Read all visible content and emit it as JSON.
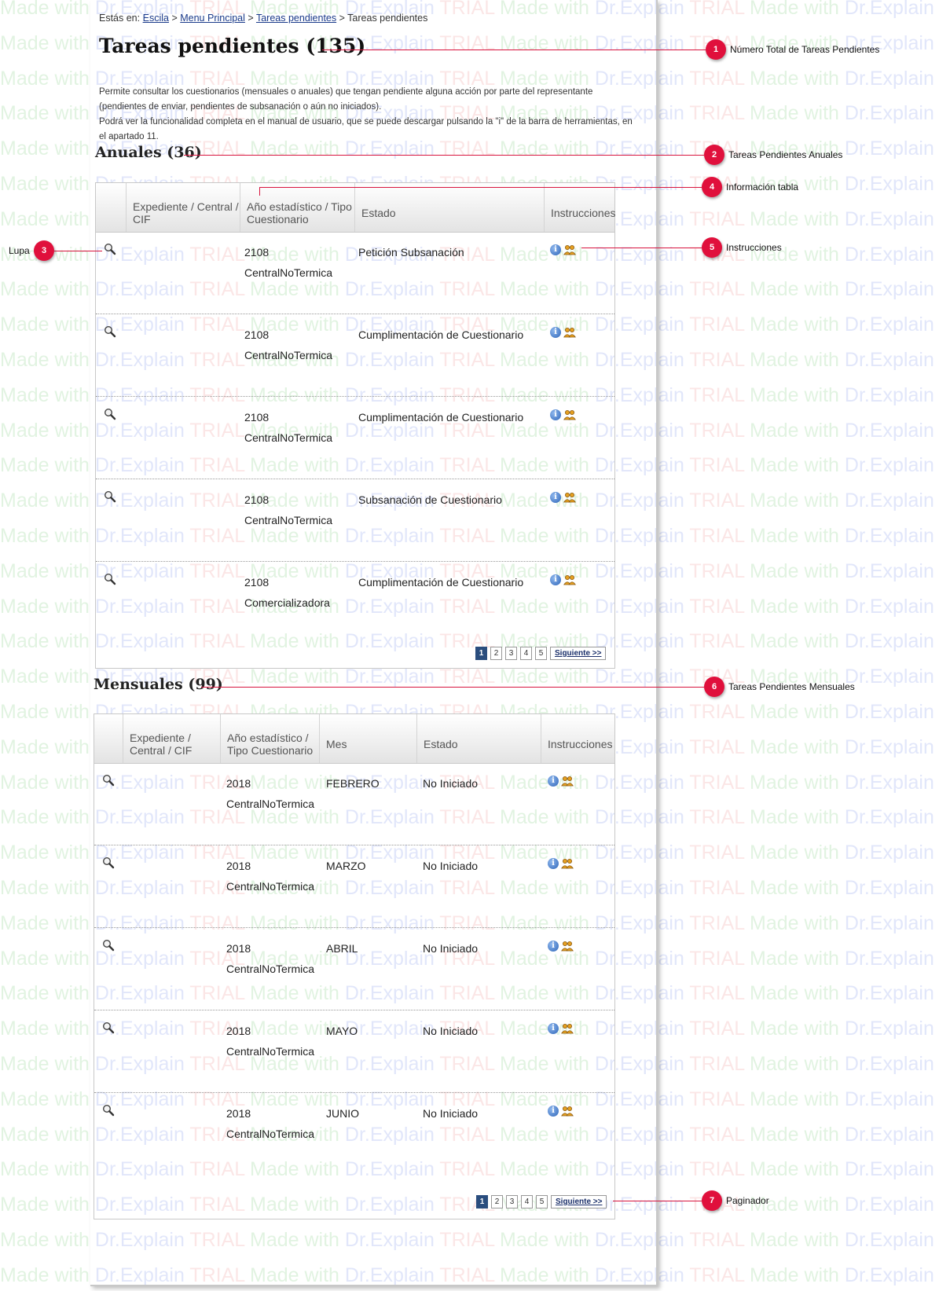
{
  "watermark": {
    "made": "Made with",
    "brand": "Dr.Explain",
    "trial": "TRIAL"
  },
  "breadcrumb": {
    "prefix": "Estás en:",
    "items": [
      "Escila",
      "Menu Principal",
      "Tareas pendientes"
    ],
    "current": "Tareas pendientes",
    "separator": ">"
  },
  "page_title": "Tareas pendientes (135)",
  "description": {
    "line1": "Permite consultar los cuestionarios (mensuales o anuales) que tengan pendiente alguna acción por parte del representante (pendientes de enviar, pendientes de subsanación o aún no iniciados).",
    "line2": "Podrá ver la funcionalidad completa en el manual de usuario, que se puede descargar pulsando la \"i\" de la barra de herramientas, en el apartado 11."
  },
  "anuales": {
    "title": "Anuales (36)",
    "headers": [
      "",
      "Expediente / Central / CIF",
      "Año estadístico / Tipo Cuestionario",
      "Estado",
      "Instrucciones"
    ],
    "rows": [
      {
        "year": "2108",
        "type": "CentralNoTermica",
        "estado": "Petición Subsanación"
      },
      {
        "year": "2108",
        "type": "CentralNoTermica",
        "estado": "Cumplimentación de Cuestionario"
      },
      {
        "year": "2108",
        "type": "CentralNoTermica",
        "estado": "Cumplimentación de Cuestionario"
      },
      {
        "year": "2108",
        "type": "CentralNoTermica",
        "estado": "Subsanación de Cuestionario"
      },
      {
        "year": "2108",
        "type": "Comercializadora",
        "estado": "Cumplimentación de Cuestionario"
      }
    ],
    "pager": {
      "pages": [
        "1",
        "2",
        "3",
        "4",
        "5"
      ],
      "active": "1",
      "next": "Siguiente >>"
    }
  },
  "mensuales": {
    "title": "Mensuales (99)",
    "headers": [
      "",
      "Expediente / Central / CIF",
      "Año estadístico / Tipo Cuestionario",
      "Mes",
      "Estado",
      "Instrucciones"
    ],
    "rows": [
      {
        "year": "2018",
        "type": "CentralNoTermica",
        "mes": "FEBRERO",
        "estado": "No Iniciado"
      },
      {
        "year": "2018",
        "type": "CentralNoTermica",
        "mes": "MARZO",
        "estado": "No Iniciado"
      },
      {
        "year": "2018",
        "type": "CentralNoTermica",
        "mes": "ABRIL",
        "estado": "No Iniciado"
      },
      {
        "year": "2018",
        "type": "CentralNoTermica",
        "mes": "MAYO",
        "estado": "No Iniciado"
      },
      {
        "year": "2018",
        "type": "CentralNoTermica",
        "mes": "JUNIO",
        "estado": "No Iniciado"
      }
    ],
    "pager": {
      "pages": [
        "1",
        "2",
        "3",
        "4",
        "5"
      ],
      "active": "1",
      "next": "Siguiente >>"
    }
  },
  "callouts": [
    {
      "num": "1",
      "label": "Número Total de Tareas Pendientes"
    },
    {
      "num": "2",
      "label": "Tareas Pendientes Anuales"
    },
    {
      "num": "3",
      "label": "Lupa"
    },
    {
      "num": "4",
      "label": "Información tabla"
    },
    {
      "num": "5",
      "label": "Instrucciones"
    },
    {
      "num": "6",
      "label": "Tareas Pendientes Mensuales"
    },
    {
      "num": "7",
      "label": "Paginador"
    }
  ],
  "colors": {
    "callout": "#e0103c",
    "pager_active": "#2a4d7e",
    "link": "#1a3a8a"
  }
}
